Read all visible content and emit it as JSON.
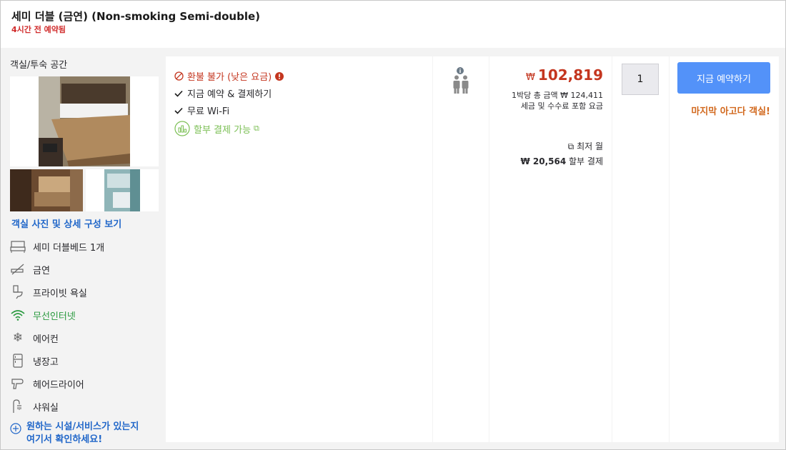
{
  "header": {
    "room_title": "세미 더블 (금연) (Non-smoking Semi-double)",
    "booked_notice": "4시간 전 예약됨"
  },
  "room_info": {
    "title": "객실/투숙 공간",
    "photo_link": "객실 사진 및 상세 구성 보기",
    "amenities": [
      {
        "icon": "bed-icon",
        "label": "세미 더블베드 1개"
      },
      {
        "icon": "no-smoking-icon",
        "label": "금연"
      },
      {
        "icon": "toilet-icon",
        "label": "프라이빗 욕실"
      },
      {
        "icon": "wifi-icon",
        "label": "무선인터넷",
        "color": "#2a9a3f"
      },
      {
        "icon": "snowflake-icon",
        "label": "에어컨"
      },
      {
        "icon": "fridge-icon",
        "label": "냉장고"
      },
      {
        "icon": "hairdryer-icon",
        "label": "헤어드라이어"
      },
      {
        "icon": "shower-icon",
        "label": "샤워실"
      }
    ],
    "more_link": {
      "line1": "원하는 시설/서비스가 있는지",
      "line2": "여기서 확인하세요!"
    }
  },
  "conditions": {
    "refund": "환불 불가 (낮은 요금)",
    "book_now": "지금 예약 & 결제하기",
    "wifi": "무료 Wi-Fi",
    "installment": "할부 결제 가능"
  },
  "occupancy": {
    "guests": 2,
    "info_icon": "info-icon"
  },
  "price": {
    "currency": "₩",
    "amount": "102,819",
    "total_line": "1박당 총 금액 ₩ 124,411",
    "tax_line": "세금 및 수수료 포함 요금",
    "monthly_label": "최저 월",
    "installment_amount": "₩ 20,564",
    "installment_suffix": "할부 결제"
  },
  "quantity": {
    "value": "1"
  },
  "booking": {
    "button_label": "지금 예약하기",
    "last_room": "마지막 아고다 객실!"
  },
  "colors": {
    "accent": "#5392f9",
    "price_red": "#c4361f",
    "link_blue": "#2167c9",
    "orange": "#d2691e",
    "green": "#7bbf54"
  }
}
